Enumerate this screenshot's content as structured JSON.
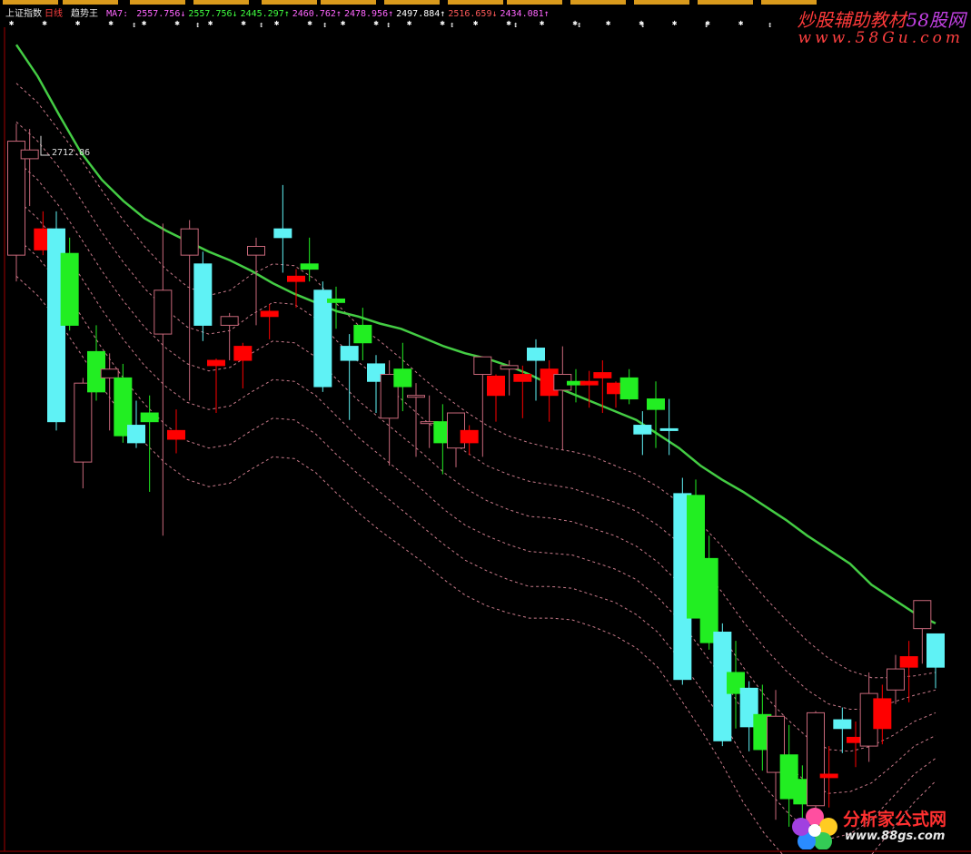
{
  "legend": {
    "index_name": "上证指数",
    "period": "日线",
    "indicator": "趋势王",
    "ma_label": "MA7:",
    "values": [
      {
        "text": "2557.756",
        "arrow": "↓",
        "color": "#ff66ff"
      },
      {
        "text": "2557.756",
        "arrow": "↓",
        "color": "#40ff40"
      },
      {
        "text": "2445.297",
        "arrow": "↑",
        "color": "#40ff40"
      },
      {
        "text": "2460.762",
        "arrow": "↑",
        "color": "#ff66ff"
      },
      {
        "text": "2478.956",
        "arrow": "↑",
        "color": "#ff66ff"
      },
      {
        "text": "2497.884",
        "arrow": "↑",
        "color": "#ffffff"
      },
      {
        "text": "2516.659",
        "arrow": "↓",
        "color": "#ff5a5a"
      },
      {
        "text": "2434.081",
        "arrow": "↑",
        "color": "#ff66ff"
      }
    ]
  },
  "watermark": {
    "title_main": "炒股辅助教材",
    "title_brand": "58股网",
    "url": "www.58Gu.com"
  },
  "logo": {
    "text": "分析家公式网",
    "url": "www.88gs.com"
  },
  "colors": {
    "background": "#000000",
    "up_body": "#ff0000",
    "up_hollow": "#c8687a",
    "down_cyan": "#5ff2f5",
    "down_green": "#22ee22",
    "ma_bold": "#44cc44",
    "ma_dashed": "#c87a8a"
  },
  "chart_data": {
    "type": "candlestick",
    "high_marker": "2712.86",
    "low_marker": "",
    "ylim": [
      2300,
      2770
    ],
    "candles": [
      {
        "o": 2640,
        "h": 2715,
        "l": 2625,
        "c": 2705,
        "color": "hollow"
      },
      {
        "o": 2695,
        "h": 2712,
        "l": 2668,
        "c": 2700,
        "color": "hollow"
      },
      {
        "o": 2655,
        "h": 2665,
        "l": 2640,
        "c": 2643,
        "color": "red"
      },
      {
        "o": 2655,
        "h": 2665,
        "l": 2540,
        "c": 2545,
        "color": "cyan"
      },
      {
        "o": 2641,
        "h": 2650,
        "l": 2597,
        "c": 2600,
        "color": "green"
      },
      {
        "o": 2522,
        "h": 2570,
        "l": 2507,
        "c": 2567,
        "color": "hollow"
      },
      {
        "o": 2585,
        "h": 2600,
        "l": 2557,
        "c": 2562,
        "color": "green"
      },
      {
        "o": 2570,
        "h": 2584,
        "l": 2540,
        "c": 2575,
        "color": "hollow"
      },
      {
        "o": 2570,
        "h": 2578,
        "l": 2533,
        "c": 2537,
        "color": "green"
      },
      {
        "o": 2543,
        "h": 2557,
        "l": 2530,
        "c": 2533,
        "color": "cyan"
      },
      {
        "o": 2550,
        "h": 2560,
        "l": 2505,
        "c": 2545,
        "color": "green"
      },
      {
        "o": 2595,
        "h": 2658,
        "l": 2480,
        "c": 2620,
        "color": "hollow"
      },
      {
        "o": 2540,
        "h": 2552,
        "l": 2527,
        "c": 2535,
        "color": "red"
      },
      {
        "o": 2640,
        "h": 2660,
        "l": 2557,
        "c": 2655,
        "color": "hollow"
      },
      {
        "o": 2635,
        "h": 2642,
        "l": 2591,
        "c": 2600,
        "color": "cyan"
      },
      {
        "o": 2577,
        "h": 2581,
        "l": 2550,
        "c": 2580,
        "color": "red"
      },
      {
        "o": 2600,
        "h": 2607,
        "l": 2580,
        "c": 2605,
        "color": "hollow"
      },
      {
        "o": 2580,
        "h": 2590,
        "l": 2564,
        "c": 2588,
        "color": "red"
      },
      {
        "o": 2640,
        "h": 2650,
        "l": 2600,
        "c": 2645,
        "color": "hollow"
      },
      {
        "o": 2605,
        "h": 2612,
        "l": 2592,
        "c": 2608,
        "color": "red"
      },
      {
        "o": 2650,
        "h": 2680,
        "l": 2630,
        "c": 2655,
        "color": "cyan"
      },
      {
        "o": 2625,
        "h": 2632,
        "l": 2610,
        "c": 2628,
        "color": "red"
      },
      {
        "o": 2635,
        "h": 2650,
        "l": 2625,
        "c": 2632,
        "color": "green"
      },
      {
        "o": 2620,
        "h": 2625,
        "l": 2562,
        "c": 2565,
        "color": "cyan"
      },
      {
        "o": 2613,
        "h": 2622,
        "l": 2598,
        "c": 2615,
        "color": "green"
      },
      {
        "o": 2588,
        "h": 2595,
        "l": 2546,
        "c": 2580,
        "color": "cyan"
      },
      {
        "o": 2600,
        "h": 2610,
        "l": 2580,
        "c": 2590,
        "color": "green"
      },
      {
        "o": 2568,
        "h": 2583,
        "l": 2550,
        "c": 2578,
        "color": "cyan"
      },
      {
        "o": 2572,
        "h": 2580,
        "l": 2520,
        "c": 2547,
        "color": "hollow"
      },
      {
        "o": 2575,
        "h": 2590,
        "l": 2551,
        "c": 2565,
        "color": "green"
      },
      {
        "o": 2560,
        "h": 2567,
        "l": 2525,
        "c": 2560,
        "color": "hollow"
      },
      {
        "o": 2545,
        "h": 2560,
        "l": 2530,
        "c": 2545,
        "color": "hollow"
      },
      {
        "o": 2545,
        "h": 2555,
        "l": 2515,
        "c": 2533,
        "color": "green"
      },
      {
        "o": 2530,
        "h": 2548,
        "l": 2519,
        "c": 2550,
        "color": "hollow"
      },
      {
        "o": 2533,
        "h": 2543,
        "l": 2526,
        "c": 2540,
        "color": "red"
      },
      {
        "o": 2572,
        "h": 2577,
        "l": 2525,
        "c": 2582,
        "color": "hollow"
      },
      {
        "o": 2560,
        "h": 2572,
        "l": 2545,
        "c": 2571,
        "color": "red"
      },
      {
        "o": 2577,
        "h": 2580,
        "l": 2560,
        "c": 2575,
        "color": "hollow"
      },
      {
        "o": 2568,
        "h": 2577,
        "l": 2547,
        "c": 2572,
        "color": "red"
      },
      {
        "o": 2580,
        "h": 2592,
        "l": 2557,
        "c": 2587,
        "color": "cyan"
      },
      {
        "o": 2575,
        "h": 2580,
        "l": 2545,
        "c": 2560,
        "color": "red"
      },
      {
        "o": 2572,
        "h": 2588,
        "l": 2529,
        "c": 2563,
        "color": "hollow"
      },
      {
        "o": 2566,
        "h": 2575,
        "l": 2556,
        "c": 2568,
        "color": "green"
      },
      {
        "o": 2568,
        "h": 2574,
        "l": 2553,
        "c": 2566,
        "color": "red"
      },
      {
        "o": 2570,
        "h": 2580,
        "l": 2550,
        "c": 2573,
        "color": "red"
      },
      {
        "o": 2561,
        "h": 2568,
        "l": 2553,
        "c": 2567,
        "color": "red"
      },
      {
        "o": 2570,
        "h": 2575,
        "l": 2555,
        "c": 2558,
        "color": "green"
      },
      {
        "o": 2543,
        "h": 2551,
        "l": 2526,
        "c": 2538,
        "color": "cyan"
      },
      {
        "o": 2558,
        "h": 2568,
        "l": 2530,
        "c": 2552,
        "color": "green"
      },
      {
        "o": 2540,
        "h": 2558,
        "l": 2526,
        "c": 2541,
        "color": "cyan"
      },
      {
        "o": 2504,
        "h": 2513,
        "l": 2395,
        "c": 2398,
        "color": "cyan"
      },
      {
        "o": 2503,
        "h": 2512,
        "l": 2435,
        "c": 2433,
        "color": "green"
      },
      {
        "o": 2467,
        "h": 2480,
        "l": 2415,
        "c": 2419,
        "color": "green"
      },
      {
        "o": 2425,
        "h": 2430,
        "l": 2360,
        "c": 2363,
        "color": "cyan"
      },
      {
        "o": 2402,
        "h": 2420,
        "l": 2370,
        "c": 2390,
        "color": "green"
      },
      {
        "o": 2393,
        "h": 2397,
        "l": 2357,
        "c": 2371,
        "color": "cyan"
      },
      {
        "o": 2378,
        "h": 2395,
        "l": 2346,
        "c": 2358,
        "color": "green"
      },
      {
        "o": 2345,
        "h": 2392,
        "l": 2318,
        "c": 2377,
        "color": "hollow"
      },
      {
        "o": 2355,
        "h": 2372,
        "l": 2314,
        "c": 2330,
        "color": "green"
      },
      {
        "o": 2341,
        "h": 2349,
        "l": 2318,
        "c": 2327,
        "color": "green"
      },
      {
        "o": 2326,
        "h": 2380,
        "l": 2318,
        "c": 2379,
        "color": "hollow"
      },
      {
        "o": 2342,
        "h": 2360,
        "l": 2325,
        "c": 2344,
        "color": "red"
      },
      {
        "o": 2370,
        "h": 2382,
        "l": 2356,
        "c": 2375,
        "color": "cyan"
      },
      {
        "o": 2362,
        "h": 2374,
        "l": 2348,
        "c": 2365,
        "color": "red"
      },
      {
        "o": 2360,
        "h": 2402,
        "l": 2351,
        "c": 2390,
        "color": "hollow"
      },
      {
        "o": 2370,
        "h": 2395,
        "l": 2361,
        "c": 2387,
        "color": "red"
      },
      {
        "o": 2392,
        "h": 2412,
        "l": 2384,
        "c": 2404,
        "color": "hollow"
      },
      {
        "o": 2405,
        "h": 2420,
        "l": 2385,
        "c": 2411,
        "color": "red"
      },
      {
        "o": 2427,
        "h": 2442,
        "l": 2407,
        "c": 2443,
        "color": "hollow"
      },
      {
        "o": 2405,
        "h": 2412,
        "l": 2393,
        "c": 2424,
        "color": "cyan"
      }
    ],
    "ma_main": [
      2760,
      2742,
      2720,
      2699,
      2683,
      2671,
      2661,
      2654,
      2648,
      2642,
      2637,
      2631,
      2624,
      2618,
      2613,
      2608,
      2605,
      2601,
      2598,
      2593,
      2588,
      2584,
      2581,
      2577,
      2572,
      2566,
      2561,
      2556,
      2551,
      2546,
      2538,
      2530,
      2520,
      2512,
      2505,
      2497,
      2489,
      2480,
      2472,
      2464,
      2452,
      2444,
      2436,
      2430
    ],
    "ma_dashed": [
      [
        2738,
        2727,
        2711,
        2695,
        2677,
        2660,
        2645,
        2632,
        2622,
        2617,
        2620,
        2629,
        2635,
        2634,
        2626,
        2612,
        2600,
        2591,
        2581,
        2570,
        2560,
        2551,
        2543,
        2537,
        2533,
        2530,
        2528,
        2525,
        2520,
        2515,
        2508,
        2499,
        2487,
        2474,
        2459,
        2445,
        2432,
        2420,
        2410,
        2403,
        2399,
        2399,
        2400,
        2402
      ],
      [
        2716,
        2705,
        2690,
        2672,
        2653,
        2636,
        2621,
        2609,
        2599,
        2595,
        2597,
        2606,
        2613,
        2612,
        2604,
        2591,
        2579,
        2569,
        2558,
        2547,
        2537,
        2528,
        2520,
        2515,
        2511,
        2509,
        2507,
        2503,
        2499,
        2494,
        2486,
        2476,
        2463,
        2448,
        2431,
        2416,
        2403,
        2392,
        2384,
        2381,
        2381,
        2385,
        2389,
        2392
      ],
      [
        2694,
        2683,
        2668,
        2650,
        2631,
        2614,
        2599,
        2587,
        2578,
        2574,
        2576,
        2584,
        2591,
        2590,
        2582,
        2569,
        2557,
        2547,
        2537,
        2527,
        2516,
        2507,
        2500,
        2495,
        2491,
        2490,
        2488,
        2484,
        2480,
        2474,
        2465,
        2453,
        2439,
        2423,
        2405,
        2389,
        2376,
        2365,
        2358,
        2357,
        2360,
        2366,
        2374,
        2379
      ],
      [
        2672,
        2661,
        2646,
        2628,
        2609,
        2592,
        2577,
        2565,
        2556,
        2552,
        2554,
        2562,
        2569,
        2568,
        2560,
        2548,
        2536,
        2526,
        2516,
        2506,
        2495,
        2486,
        2480,
        2475,
        2471,
        2470,
        2469,
        2465,
        2461,
        2455,
        2445,
        2432,
        2416,
        2399,
        2380,
        2364,
        2350,
        2339,
        2333,
        2334,
        2339,
        2349,
        2360,
        2366
      ],
      [
        2650,
        2639,
        2624,
        2606,
        2587,
        2570,
        2555,
        2543,
        2534,
        2530,
        2532,
        2540,
        2547,
        2546,
        2538,
        2526,
        2515,
        2505,
        2495,
        2485,
        2475,
        2466,
        2460,
        2455,
        2451,
        2451,
        2450,
        2446,
        2442,
        2435,
        2425,
        2410,
        2393,
        2375,
        2354,
        2337,
        2323,
        2312,
        2307,
        2310,
        2318,
        2331,
        2344,
        2353
      ],
      [
        2628,
        2617,
        2602,
        2584,
        2565,
        2548,
        2533,
        2521,
        2512,
        2508,
        2510,
        2518,
        2525,
        2524,
        2516,
        2504,
        2493,
        2483,
        2474,
        2465,
        2455,
        2446,
        2440,
        2436,
        2433,
        2433,
        2432,
        2428,
        2423,
        2416,
        2405,
        2388,
        2370,
        2350,
        2328,
        2310,
        2296,
        2287,
        2283,
        2288,
        2298,
        2313,
        2328,
        2340
      ]
    ]
  }
}
